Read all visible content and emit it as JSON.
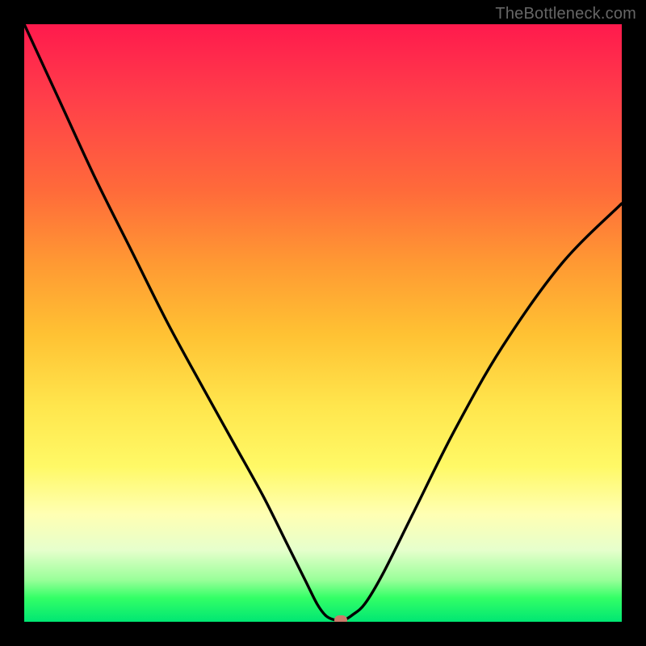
{
  "watermark": "TheBottleneck.com",
  "chart_data": {
    "type": "line",
    "title": "",
    "xlabel": "",
    "ylabel": "",
    "xlim": [
      0,
      100
    ],
    "ylim": [
      0,
      100
    ],
    "grid": false,
    "series": [
      {
        "name": "bottleneck-curve",
        "x": [
          0,
          6,
          12,
          18,
          24,
          30,
          35,
          40,
          44,
          47,
          49,
          50.5,
          52,
          53.5,
          55,
          57,
          60,
          65,
          72,
          80,
          90,
          100
        ],
        "y": [
          100,
          87,
          74,
          62,
          50,
          39,
          30,
          21,
          13,
          7,
          3,
          1,
          0.3,
          0.3,
          1.2,
          3,
          8,
          18,
          32,
          46,
          60,
          70
        ]
      }
    ],
    "marker": {
      "x": 53,
      "y": 0.3,
      "color": "#cc7a6a"
    },
    "background_gradient": {
      "type": "vertical",
      "stops": [
        {
          "pos": 0.0,
          "color": "#ff1a4d"
        },
        {
          "pos": 0.28,
          "color": "#ff6b3a"
        },
        {
          "pos": 0.52,
          "color": "#ffc233"
        },
        {
          "pos": 0.74,
          "color": "#fff966"
        },
        {
          "pos": 0.88,
          "color": "#e6ffcc"
        },
        {
          "pos": 1.0,
          "color": "#00e673"
        }
      ]
    }
  }
}
